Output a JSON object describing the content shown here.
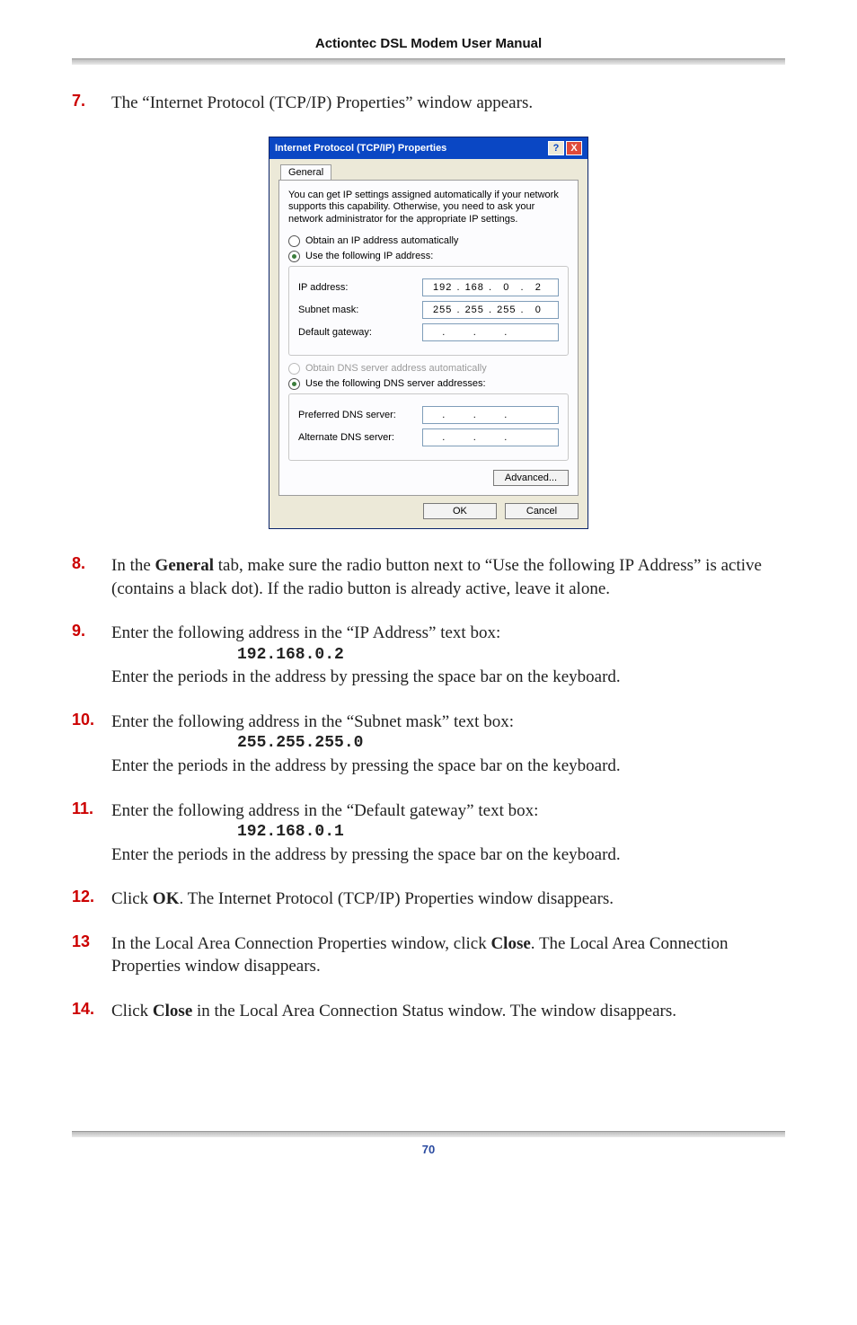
{
  "header": {
    "title": "Actiontec DSL Modem User Manual"
  },
  "steps": {
    "s7": {
      "num": "7.",
      "text_a": "The “Internet Protocol (",
      "text_tcpip": "TCP/IP",
      "text_b": ") Properties” window appears."
    },
    "s8": {
      "num": "8.",
      "a": "In the ",
      "b": "General",
      "c": " tab, make sure the radio button next to “Use the following ",
      "ip": "IP",
      "d": " Address” is active (contains a black dot). If the radio button is already active, leave it alone."
    },
    "s9": {
      "num": "9.",
      "a": "Enter the following address in the “",
      "ip": "IP",
      "b": " Address” text box:",
      "code": "192.168.0.2",
      "c": "Enter the periods in the address by pressing the space bar on the keyboard."
    },
    "s10": {
      "num": "10.",
      "a": "Enter the following address in the “Subnet mask” text box:",
      "code": "255.255.255.0",
      "b": "Enter the periods in the address by pressing the space bar on the keyboard."
    },
    "s11": {
      "num": "11.",
      "a": "Enter the following address in the “Default gateway” text box:",
      "code": "192.168.0.1",
      "b": "Enter the periods in the address by pressing the space bar on the keyboard."
    },
    "s12": {
      "num": "12.",
      "a": "Click ",
      "b": "OK",
      "c": ". The Internet Protocol (",
      "d": "TCP/IP",
      "e": ") Properties window disappears."
    },
    "s13": {
      "num": "13",
      "a": "In the Local Area Connection Properties window, click ",
      "b": "Close",
      "c": ". The Local Area Connection Properties window disappears."
    },
    "s14": {
      "num": "14.",
      "a": "Click ",
      "b": "Close",
      "c": " in the Local Area Connection Status window. The window disappears."
    }
  },
  "dialog": {
    "title": "Internet Protocol (TCP/IP) Properties",
    "help": "?",
    "close": "X",
    "tab": "General",
    "desc": "You can get IP settings assigned automatically if your network supports this capability. Otherwise, you need to ask your network administrator for the appropriate IP settings.",
    "radio_auto_ip": "Obtain an IP address automatically",
    "radio_use_ip": "Use the following IP address:",
    "label_ip": "IP address:",
    "ip": {
      "a": "192",
      "b": "168",
      "c": "0",
      "d": "2"
    },
    "label_subnet": "Subnet mask:",
    "subnet": {
      "a": "255",
      "b": "255",
      "c": "255",
      "d": "0"
    },
    "label_gateway": "Default gateway:",
    "gw": {
      "a": ".",
      "b": ".",
      "c": ".",
      "d": ""
    },
    "radio_auto_dns": "Obtain DNS server address automatically",
    "radio_use_dns": "Use the following DNS server addresses:",
    "label_pref_dns": "Preferred DNS server:",
    "label_alt_dns": "Alternate DNS server:",
    "btn_advanced": "Advanced...",
    "btn_ok": "OK",
    "btn_cancel": "Cancel"
  },
  "footer": {
    "page": "70"
  }
}
